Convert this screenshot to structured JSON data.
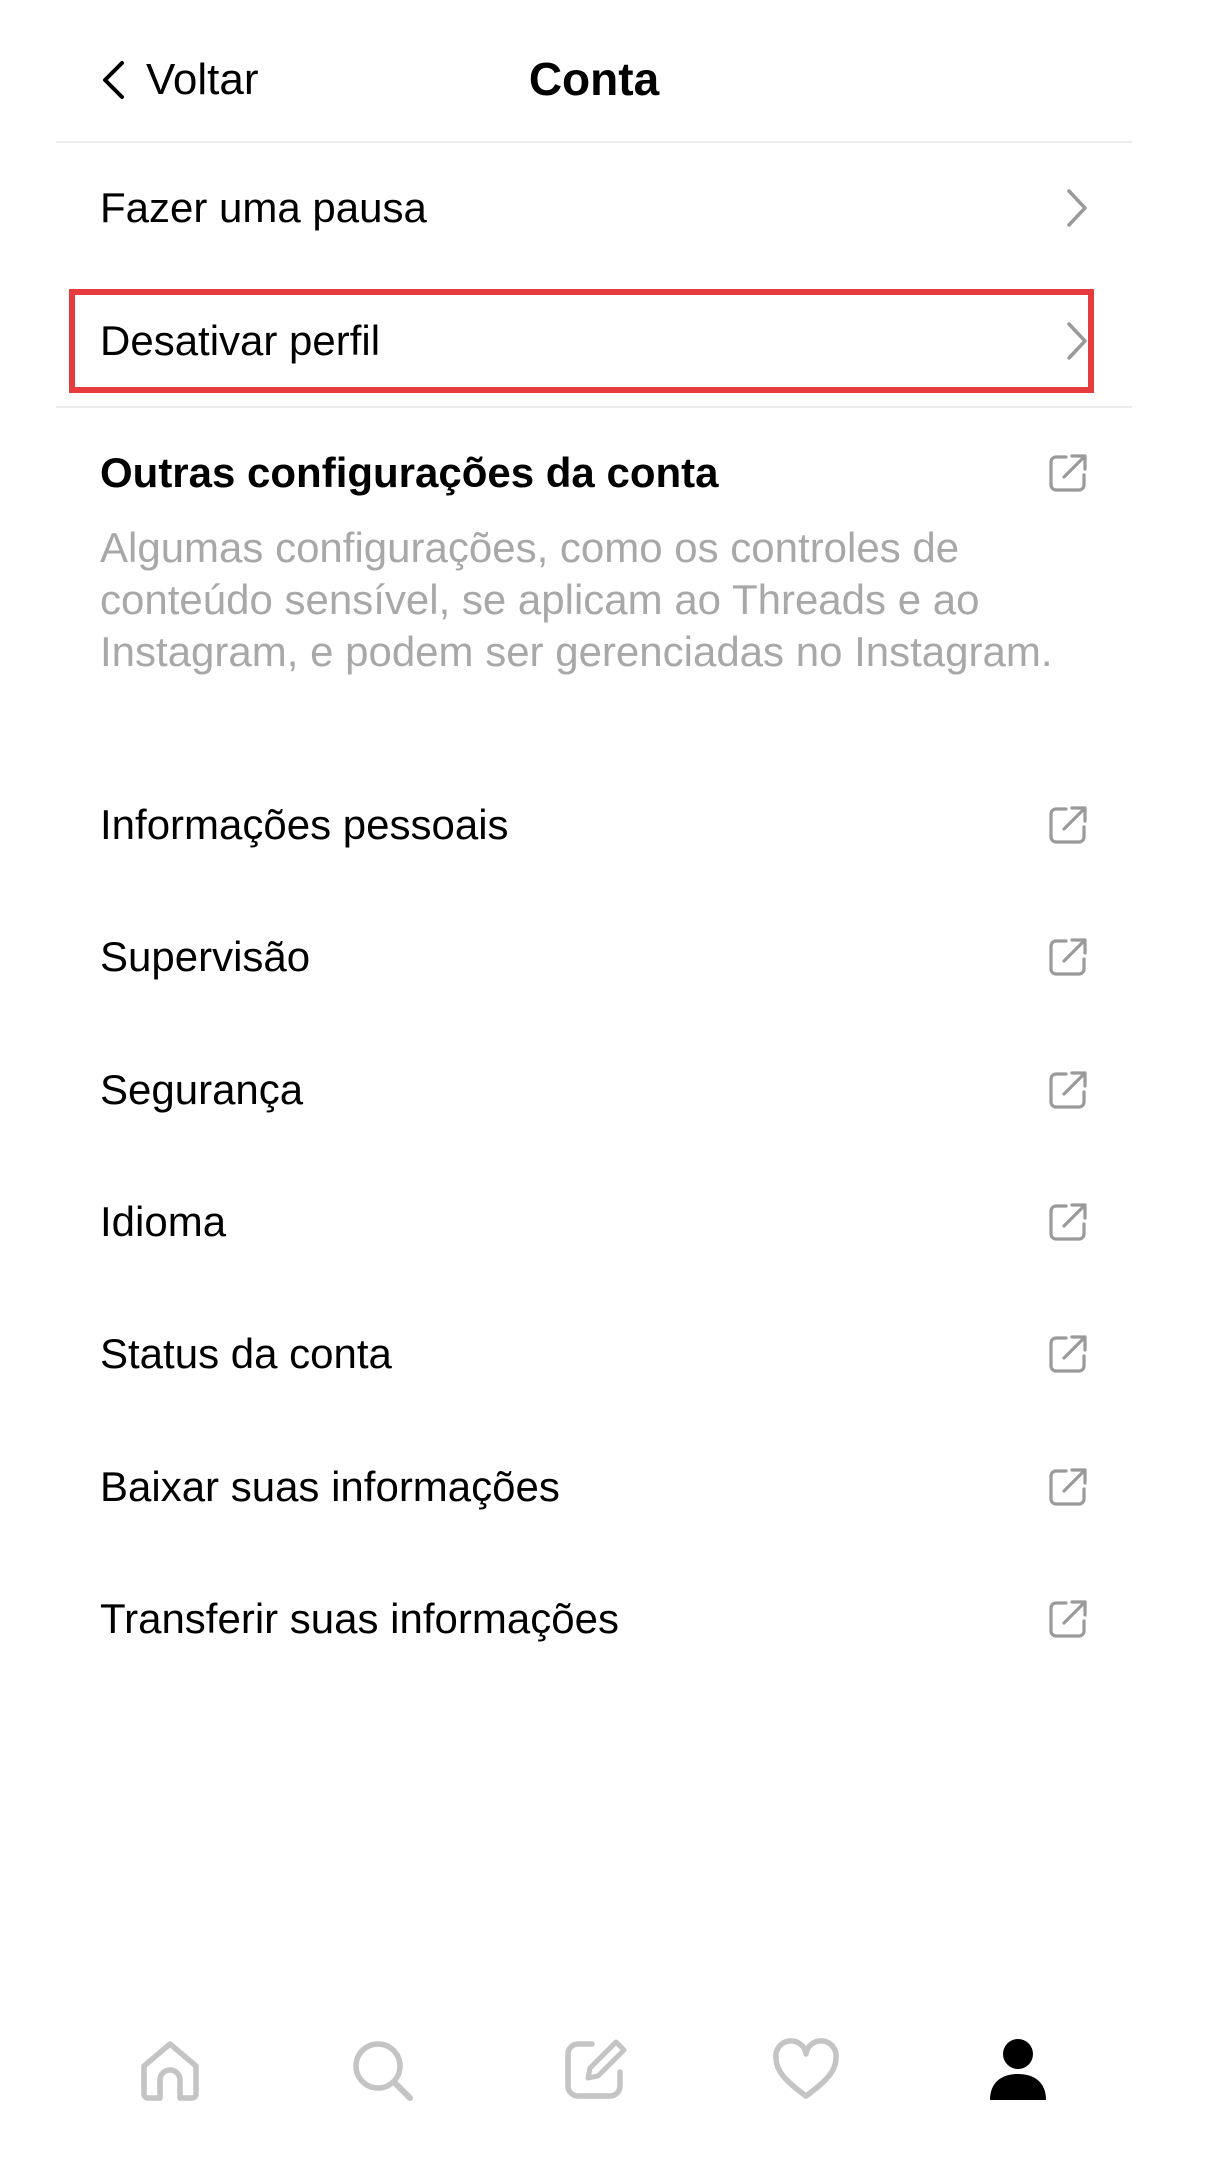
{
  "header": {
    "back_label": "Voltar",
    "title": "Conta"
  },
  "menu": {
    "pause": "Fazer uma pausa",
    "deactivate": "Desativar perfil"
  },
  "other_settings": {
    "title": "Outras configurações da conta",
    "description": "Algumas configurações, como os controles de conteúdo sensível, se aplicam ao Threads e ao Instagram, e podem ser gerenciadas no Instagram.",
    "items": [
      "Informações pessoais",
      "Supervisão",
      "Segurança",
      "Idioma",
      "Status da conta",
      "Baixar suas informações",
      "Transferir suas informações"
    ]
  },
  "icons": {
    "back": "chevron-left-icon",
    "chevron": "chevron-right-icon",
    "external": "external-link-icon",
    "tabs": [
      "home-icon",
      "search-icon",
      "compose-icon",
      "heart-icon",
      "profile-icon"
    ]
  },
  "colors": {
    "highlight_border": "#e63c3e",
    "muted_text": "#a8a8a8",
    "icon_gray": "#9a9a9a",
    "tab_inactive": "#c4c4c4",
    "tab_active": "#000000"
  }
}
